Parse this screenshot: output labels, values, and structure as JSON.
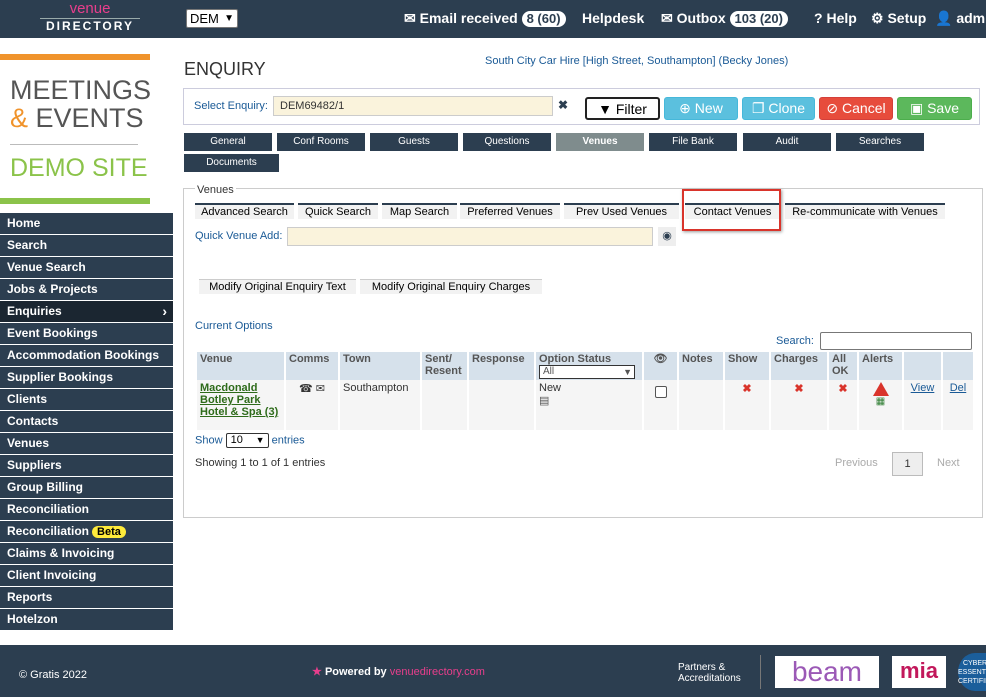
{
  "header": {
    "logo_line1": "venue",
    "logo_line2": "DIRECTORY",
    "account_select": "DEM",
    "email_received_label": "Email received",
    "email_received_count": "8 (60)",
    "helpdesk": "Helpdesk",
    "outbox_label": "Outbox",
    "outbox_count": "103 (20)",
    "help": "Help",
    "setup": "Setup",
    "user": "admin"
  },
  "brand": {
    "meetings": "MEETINGS",
    "amp": "&",
    "events": "EVENTS",
    "demo": "DEMO SITE"
  },
  "sidebar": {
    "items": [
      {
        "label": "Home"
      },
      {
        "label": "Search"
      },
      {
        "label": "Venue Search"
      },
      {
        "label": "Jobs & Projects"
      },
      {
        "label": "Enquiries"
      },
      {
        "label": "Event Bookings"
      },
      {
        "label": "Accommodation Bookings"
      },
      {
        "label": "Supplier Bookings"
      },
      {
        "label": "Clients"
      },
      {
        "label": "Contacts"
      },
      {
        "label": "Venues"
      },
      {
        "label": "Suppliers"
      },
      {
        "label": "Group Billing"
      },
      {
        "label": "Reconciliation"
      },
      {
        "label": "Reconciliation",
        "badge": "Beta"
      },
      {
        "label": "Claims & Invoicing"
      },
      {
        "label": "Client Invoicing"
      },
      {
        "label": "Reports"
      },
      {
        "label": "Hotelzon"
      }
    ]
  },
  "page": {
    "title": "ENQUIRY",
    "client_link": "South City Car Hire [High Street, Southampton] (Becky Jones)"
  },
  "enquiry_bar": {
    "label": "Select Enquiry:",
    "value": "DEM69482/1",
    "clear": "✖",
    "filter": "Filter",
    "new": "New",
    "clone": "Clone",
    "cancel": "Cancel",
    "save": "Save"
  },
  "tabs": [
    {
      "label": "General"
    },
    {
      "label": "Conf Rooms"
    },
    {
      "label": "Guests"
    },
    {
      "label": "Questions"
    },
    {
      "label": "Venues",
      "active": true
    },
    {
      "label": "File Bank"
    },
    {
      "label": "Audit"
    },
    {
      "label": "Searches"
    },
    {
      "label": "Documents"
    }
  ],
  "venues": {
    "legend": "Venues",
    "subtabs": [
      {
        "label": "Advanced Search"
      },
      {
        "label": "Quick Search"
      },
      {
        "label": "Map Search"
      },
      {
        "label": "Preferred Venues"
      },
      {
        "label": "Prev Used Venues"
      },
      {
        "label": "Contact Venues"
      },
      {
        "label": "Re-communicate with Venues"
      }
    ],
    "quick_add_label": "Quick Venue Add:",
    "modify_text": "Modify Original Enquiry Text",
    "modify_charges": "Modify Original Enquiry Charges",
    "current_options": "Current Options",
    "search_label": "Search:",
    "table": {
      "headers": [
        "Venue",
        "Comms",
        "Town",
        "Sent/ Resent",
        "Response",
        "Option Status",
        "Notes",
        "Show",
        "Charges",
        "All OK",
        "Alerts"
      ],
      "option_status_filter": "All",
      "rows": [
        {
          "venue": "Macdonald Botley Park Hotel & Spa (3)",
          "town": "Southampton",
          "option_status": "New",
          "show": "✖",
          "charges": "✖",
          "all_ok": "✖",
          "view": "View",
          "del": "Del"
        }
      ]
    },
    "show_label": "Show",
    "page_length": "10",
    "entries_label": "entries",
    "info": "Showing 1 to 1 of 1 entries",
    "previous": "Previous",
    "page": "1",
    "next": "Next"
  },
  "footer": {
    "copyright": "© Gratis 2022",
    "powered_prefix": "Powered by",
    "powered_brand": "venuedirectory.com",
    "partners_line1": "Partners &",
    "partners_line2": "Accreditations",
    "beam": "beam",
    "mia": "mia",
    "cyber": "CYBER ESSENTIALS CERTIFIED"
  },
  "colors": {
    "navy": "#2c3e50",
    "accent_orange": "#f0932b",
    "accent_green": "#8bc34a",
    "cancel_red": "#e74c3c",
    "save_green": "#5cb85c",
    "info_blue": "#5bc0de"
  }
}
